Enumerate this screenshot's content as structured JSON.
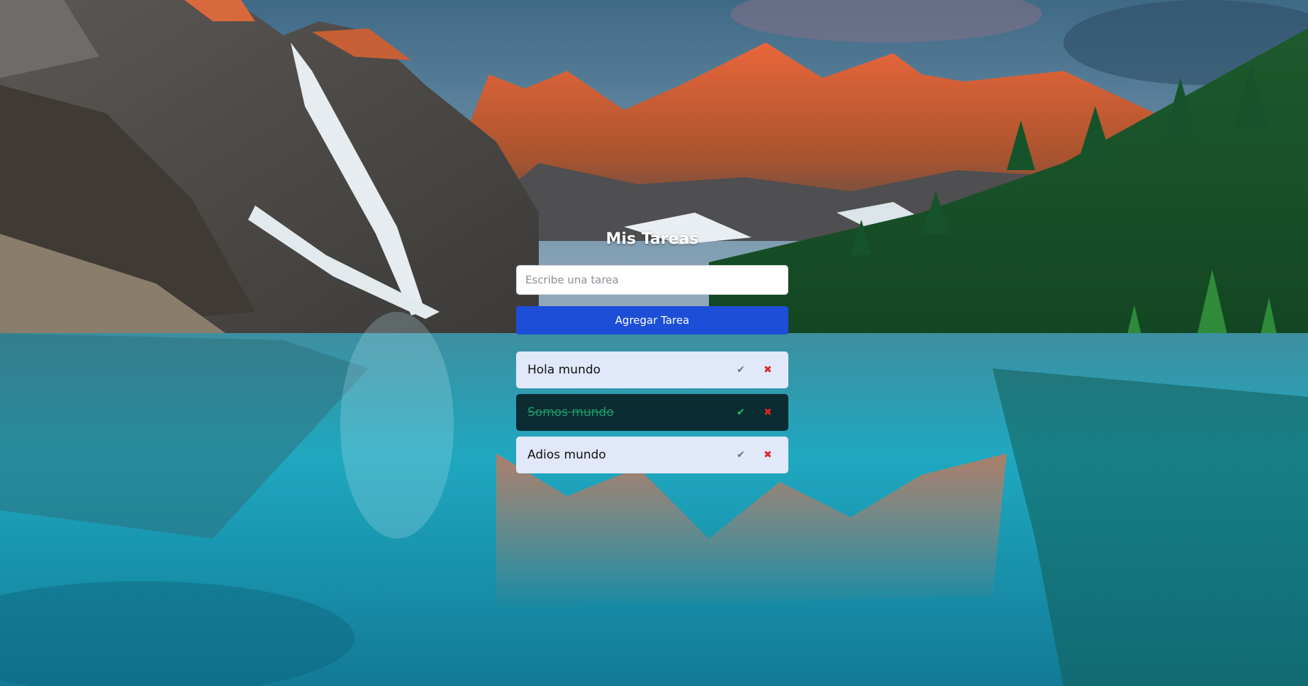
{
  "app": {
    "title": "Mis Tareas",
    "input_placeholder": "Escribe una tarea",
    "input_value": "",
    "add_button_label": "Agregar Tarea"
  },
  "tasks": [
    {
      "text": "Hola mundo",
      "completed": false,
      "check_icon": "✔",
      "delete_icon": "✖"
    },
    {
      "text": "Somos mundo",
      "completed": true,
      "check_icon": "✔",
      "delete_icon": "✖"
    },
    {
      "text": "Adios mundo",
      "completed": false,
      "check_icon": "✔",
      "delete_icon": "✖"
    }
  ],
  "colors": {
    "accent": "#1d4ed8",
    "task_bg": "#e0e8f9",
    "done_text": "#1f9d6b",
    "delete": "#dc2626"
  }
}
